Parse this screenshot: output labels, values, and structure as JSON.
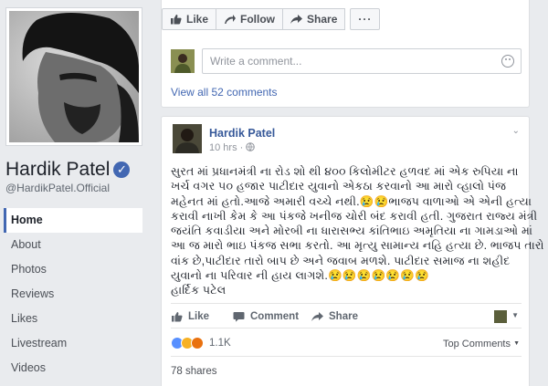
{
  "page": {
    "name": "Hardik Patel",
    "handle": "@HardikPatel.Official",
    "verified_mark": "✓"
  },
  "nav": {
    "items": [
      {
        "label": "Home",
        "active": true
      },
      {
        "label": "About"
      },
      {
        "label": "Photos"
      },
      {
        "label": "Reviews"
      },
      {
        "label": "Likes"
      },
      {
        "label": "Livestream"
      },
      {
        "label": "Videos"
      }
    ]
  },
  "top_actions": {
    "like": "Like",
    "follow": "Follow",
    "share": "Share",
    "more": "···"
  },
  "comments": {
    "placeholder": "Write a comment...",
    "view_all": "View all 52 comments"
  },
  "post": {
    "author": "Hardik Patel",
    "time": "10 hrs",
    "time_sep": "·",
    "chevron": "⌄",
    "lines": [
      "સુરત માં પ્રધાનમંત્રી ના રોડ શો થી ૪૦૦ કિલોમીટર હળવદ માં એક રુપિયા ના",
      "ખર્ચ વગર ૫૦ હજાર પાટીદાર યુવાનો એકઠા કરવાનો આ મારો વ્હાલો પંજ",
      "મહેનત માં હતો.આજે અમારી વચ્ચે નથી.😢😢ભાજપ વાળાઓ એ એની હત્યા",
      "કરાવી નાખી કેમ કે આ પંકજે ખનીજ ચોરી બંદ કરાવી હતી. ગુજરાત રાજ્ય મંત્રી",
      "જયંતિ કવાડીયા અને મોરબી ના ધારાસભ્ય કાંતિભાઇ અમૃતિયા ના ગામડાઓ માં",
      "આ જ મારો ભાઇ પંકજ સભા કરતો. આ મૃત્યુ સામાન્ય નહિ હત્યા છે. ભાજપ તારો",
      "વાંક છે,પાટીદાર તારો બાપ છે અને જવાબ મળશે. પાટીદાર સમાજ ના શહીદ",
      "યુવાનો ના પરિવાર ની હાય લાગશે.😢😢😢😢😢😢😢",
      "હાર્દિક પટેલ"
    ],
    "actions": {
      "like": "Like",
      "comment": "Comment",
      "share": "Share"
    },
    "reactions_count": "1.1K",
    "top_comments": "Top Comments",
    "shares": "78 shares"
  },
  "colors": {
    "brand": "#4267b2",
    "link": "#365899",
    "background": "#e9ebee"
  },
  "icons": [
    "thumbs-up-icon",
    "follow-icon",
    "share-arrow-icon",
    "more-icon",
    "emoji-icon",
    "globe-icon",
    "comment-icon"
  ]
}
